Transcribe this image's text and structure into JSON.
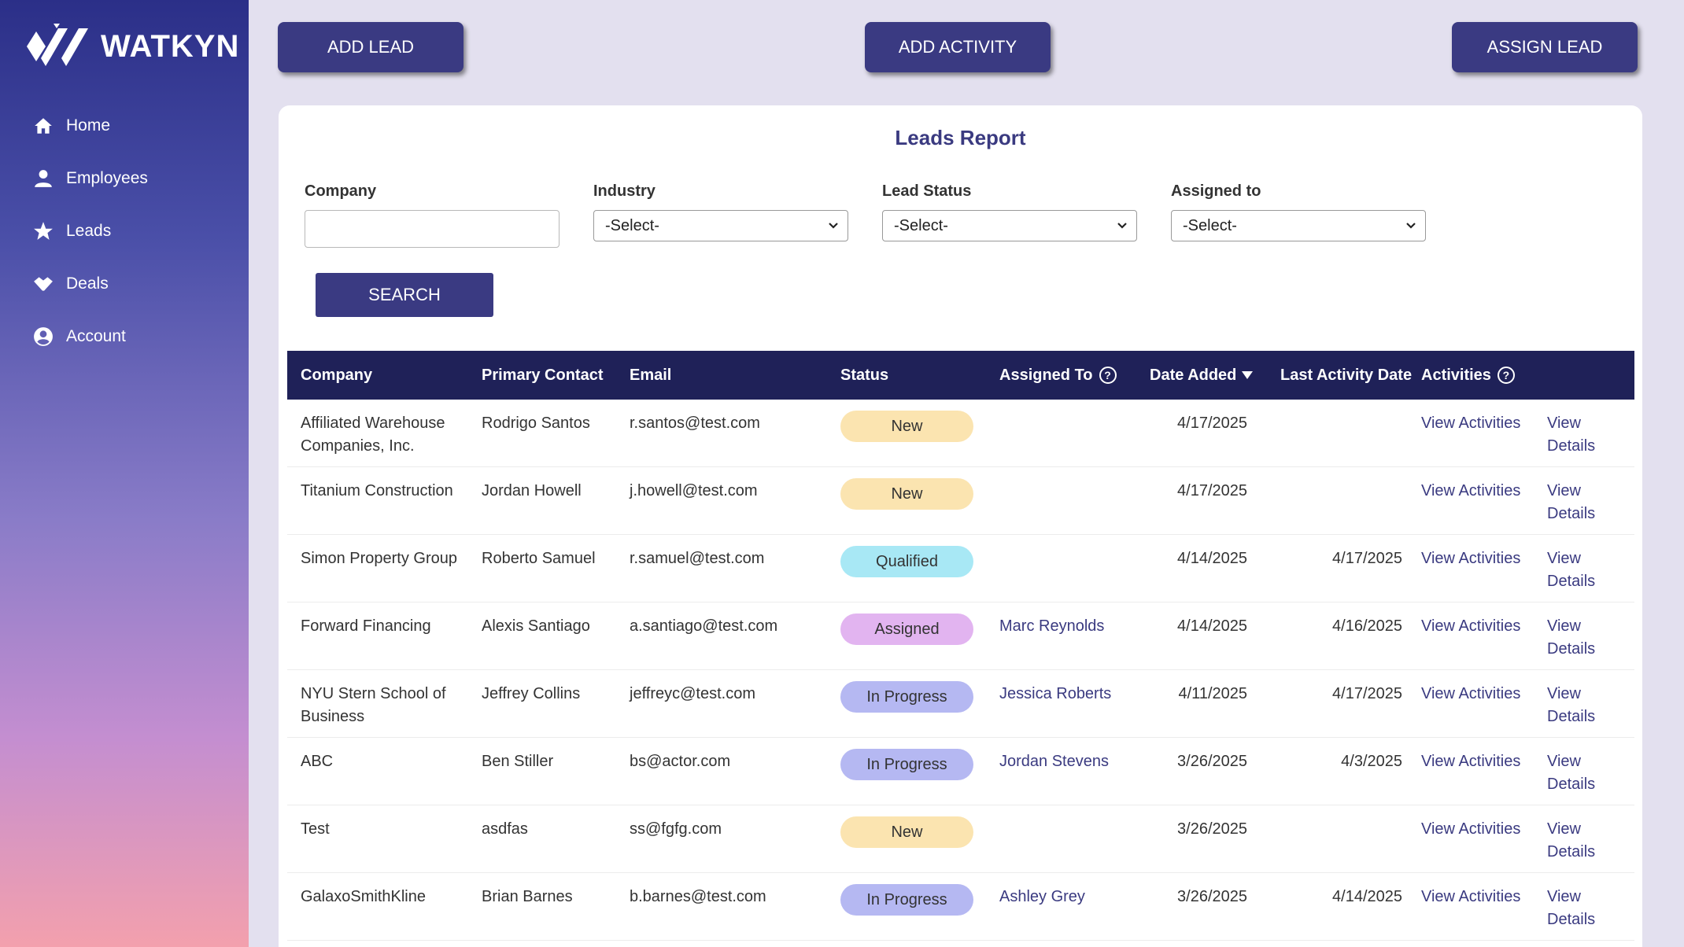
{
  "brand": {
    "name": "WATKYN"
  },
  "sidebar": {
    "items": [
      {
        "label": "Home",
        "icon": "home-icon"
      },
      {
        "label": "Employees",
        "icon": "user-icon"
      },
      {
        "label": "Leads",
        "icon": "star-icon"
      },
      {
        "label": "Deals",
        "icon": "handshake-icon"
      },
      {
        "label": "Account",
        "icon": "account-circle-icon"
      }
    ]
  },
  "toolbar": {
    "add_lead": "ADD LEAD",
    "add_activity": "ADD ACTIVITY",
    "assign_lead": "ASSIGN LEAD"
  },
  "report": {
    "title": "Leads Report",
    "filters": {
      "company_label": "Company",
      "company_value": "",
      "industry_label": "Industry",
      "industry_value": "-Select-",
      "status_label": "Lead Status",
      "status_value": "-Select-",
      "assigned_label": "Assigned to",
      "assigned_value": "-Select-"
    },
    "search_label": "SEARCH",
    "columns": {
      "company": "Company",
      "contact": "Primary Contact",
      "email": "Email",
      "status": "Status",
      "assigned": "Assigned To",
      "date": "Date Added",
      "last": "Last Activity Date",
      "acts": "Activities"
    },
    "rows": [
      {
        "company": "Affiliated Warehouse Companies, Inc.",
        "contact": "Rodrigo Santos",
        "email": "r.santos@test.com",
        "status": "New",
        "assigned": "",
        "date": "4/17/2025",
        "last": "",
        "acts": "View Activities",
        "details": "View Details"
      },
      {
        "company": "Titanium Construction",
        "contact": "Jordan Howell",
        "email": "j.howell@test.com",
        "status": "New",
        "assigned": "",
        "date": "4/17/2025",
        "last": "",
        "acts": "View Activities",
        "details": "View Details"
      },
      {
        "company": "Simon Property Group",
        "contact": "Roberto Samuel",
        "email": "r.samuel@test.com",
        "status": "Qualified",
        "assigned": "",
        "date": "4/14/2025",
        "last": "4/17/2025",
        "acts": "View Activities",
        "details": "View Details"
      },
      {
        "company": "Forward Financing",
        "contact": "Alexis Santiago",
        "email": "a.santiago@test.com",
        "status": "Assigned",
        "assigned": "Marc Reynolds",
        "date": "4/14/2025",
        "last": "4/16/2025",
        "acts": "View Activities",
        "details": "View Details"
      },
      {
        "company": "NYU Stern School of Business",
        "contact": "Jeffrey Collins",
        "email": "jeffreyc@test.com",
        "status": "In Progress",
        "assigned": "Jessica Roberts",
        "date": "4/11/2025",
        "last": "4/17/2025",
        "acts": "View Activities",
        "details": "View Details"
      },
      {
        "company": "ABC",
        "contact": "Ben Stiller",
        "email": "bs@actor.com",
        "status": "In Progress",
        "assigned": "Jordan Stevens",
        "date": "3/26/2025",
        "last": "4/3/2025",
        "acts": "View Activities",
        "details": "View Details"
      },
      {
        "company": "Test",
        "contact": "asdfas",
        "email": "ss@fgfg.com",
        "status": "New",
        "assigned": "",
        "date": "3/26/2025",
        "last": "",
        "acts": "View Activities",
        "details": "View Details"
      },
      {
        "company": "GalaxoSmithKline",
        "contact": "Brian Barnes",
        "email": "b.barnes@test.com",
        "status": "In Progress",
        "assigned": "Ashley Grey",
        "date": "3/26/2025",
        "last": "4/14/2025",
        "acts": "View Activities",
        "details": "View Details"
      }
    ]
  },
  "status_colors": {
    "New": "#fbe4b0",
    "Qualified": "#a8e8f5",
    "Assigned": "#e2b4f0",
    "In Progress": "#b5b8f2"
  }
}
